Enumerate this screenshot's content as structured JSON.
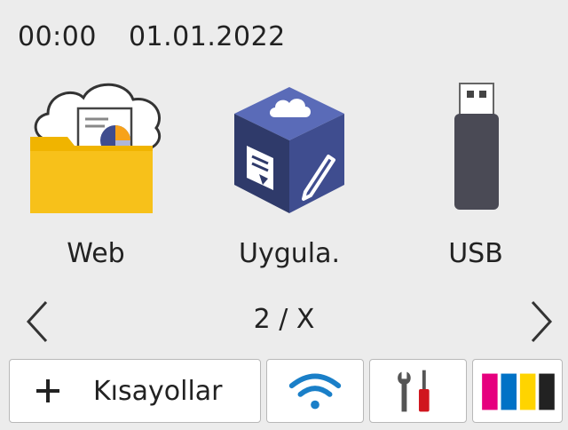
{
  "status": {
    "time": "00:00",
    "date": "01.01.2022"
  },
  "tiles": [
    {
      "label": "Web",
      "icon": "web-folder-cloud-icon"
    },
    {
      "label": "Uygula.",
      "icon": "apps-cube-icon"
    },
    {
      "label": "USB",
      "icon": "usb-drive-icon"
    }
  ],
  "pager": {
    "indicator": "2 / X",
    "prev_icon": "chevron-left-icon",
    "next_icon": "chevron-right-icon"
  },
  "bottom_bar": {
    "shortcuts_label": "Kısayollar",
    "shortcuts_icon": "plus-icon",
    "wifi_icon": "wifi-icon",
    "settings_icon": "wrench-screwdriver-icon",
    "toner_icon": "toner-icon"
  },
  "colors": {
    "background": "#ececec",
    "folder": "#f7c11a",
    "cube_dark": "#2f3a6a",
    "cube_mid": "#3f4d8f",
    "cube_light": "#5a6bb8",
    "usb": "#4a4a55",
    "toner_magenta": "#e6007e",
    "toner_cyan": "#0072c6",
    "toner_yellow": "#ffd400",
    "toner_black": "#222222",
    "screwdriver_red": "#d0161e"
  }
}
